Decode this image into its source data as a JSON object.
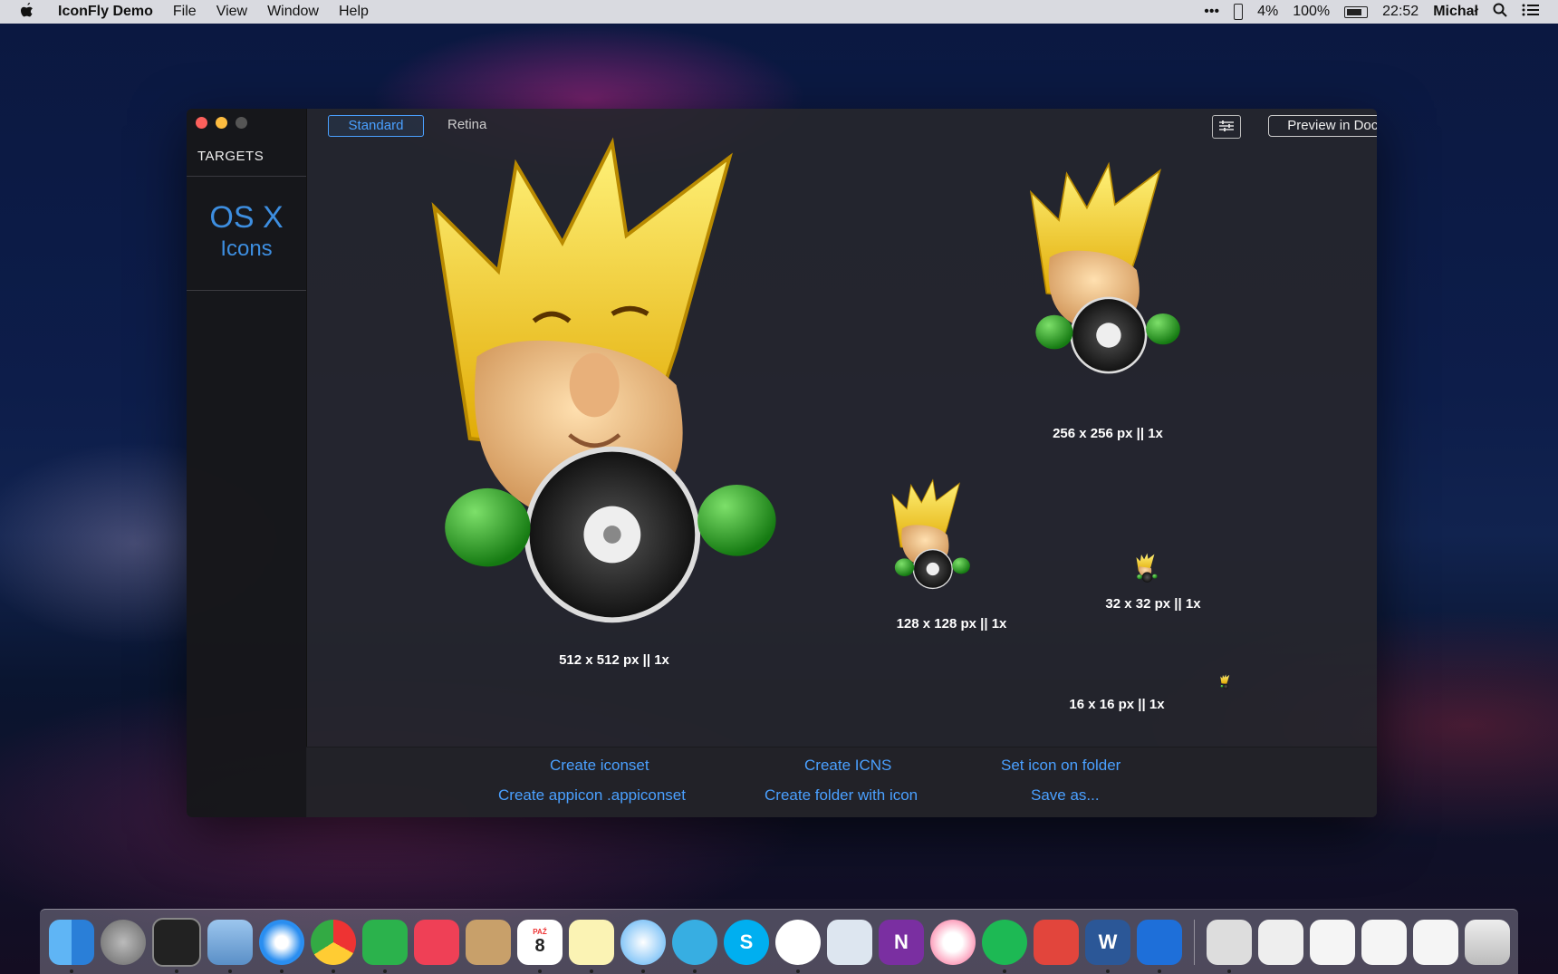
{
  "menubar": {
    "apple": "",
    "app_name": "IconFly Demo",
    "items": [
      "File",
      "View",
      "Window",
      "Help"
    ],
    "right": {
      "more": "•••",
      "phone_battery": "4%",
      "battery": "100%",
      "time": "22:52",
      "user": "Michał"
    }
  },
  "sidebar": {
    "section_label": "TARGETS",
    "target": {
      "title": "OS X",
      "subtitle": "Icons"
    }
  },
  "toolbar": {
    "tabs": [
      "Standard",
      "Retina"
    ],
    "selected_tab": "Standard",
    "preview_button": "Preview in Dock"
  },
  "previews": [
    {
      "label": "512 x 512 px   ||   1x"
    },
    {
      "label": "256 x 256 px   ||   1x"
    },
    {
      "label": "128 x 128 px   ||   1x"
    },
    {
      "label": "32 x 32 px   ||   1x"
    },
    {
      "label": "16 x 16 px   ||   1x"
    }
  ],
  "actions": {
    "create_iconset": "Create iconset",
    "create_icns": "Create ICNS",
    "set_icon_on_folder": "Set icon on folder",
    "create_appiconset": "Create appicon .appiconset",
    "create_folder_with_icon": "Create folder with icon",
    "save_as": "Save as..."
  },
  "dock": {
    "apps": [
      "finder",
      "launchpad",
      "activity",
      "preview",
      "safari",
      "chrome",
      "feedly",
      "pocket",
      "contacts",
      "calendar",
      "notes",
      "messages",
      "telegram",
      "skype",
      "messenger",
      "photos-slideshow",
      "onenote",
      "itunes",
      "spotify",
      "installer",
      "word",
      "xcode"
    ],
    "calendar_month": "PAŹ",
    "calendar_day": "8"
  },
  "colors": {
    "accent": "#4aa0ff",
    "window_bg": "#26262c",
    "sidebar_bg": "#16161a"
  }
}
